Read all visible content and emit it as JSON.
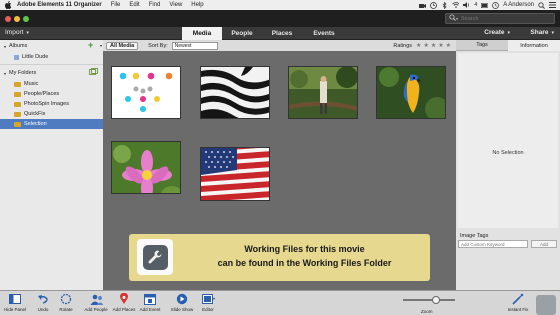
{
  "menubar": {
    "app_name": "Adobe Elements 11 Organizer",
    "items": [
      "File",
      "Edit",
      "Find",
      "View",
      "Help"
    ],
    "battery_count": "4",
    "user": "A Anderson"
  },
  "search": {
    "placeholder": "Search"
  },
  "tabbar": {
    "import_label": "Import",
    "tabs": [
      {
        "label": "Media"
      },
      {
        "label": "People"
      },
      {
        "label": "Places"
      },
      {
        "label": "Events"
      }
    ],
    "create_label": "Create",
    "share_label": "Share"
  },
  "left_panel": {
    "albums_header": "Albums",
    "album_items": [
      "Little Dude"
    ],
    "folders_header": "My Folders",
    "folder_items": [
      "Music",
      "People/Places",
      "PhotoSpin Images",
      "QuickFix",
      "Selection"
    ]
  },
  "media_bar": {
    "all_media_label": "All Media",
    "sort_by_label": "Sort By:",
    "sort_value": "Newest",
    "ratings_label": "Ratings"
  },
  "right_panel": {
    "tabs": [
      "Tags",
      "Information"
    ],
    "no_selection": "No Selection",
    "image_tags_header": "Image Tags",
    "tag_placeholder": "Add Custom Keyword",
    "add_label": "Add"
  },
  "banner": {
    "line1": "Working Files for this movie",
    "line2": "can be found in the Working Files Folder"
  },
  "bottom_toolbar": {
    "hide_panel": "Hide Panel",
    "undo": "Undo",
    "rotate": "Rotate",
    "add_people": "Add People",
    "add_places": "Add Places",
    "add_event": "Add Event",
    "slide_show": "Slide Show",
    "editor": "Editor",
    "zoom": "Zoom",
    "instant_fix": "Instant Fix"
  },
  "colors": {
    "accent_blue": "#4f7cc1",
    "banner_bg": "#e6d88f",
    "grid_bg": "#6b6b6b",
    "dot_colors": [
      "#27c6ea",
      "#f0c93a",
      "#e8318e",
      "#f08030",
      "#9a9a9a",
      "#27c6ea"
    ]
  }
}
